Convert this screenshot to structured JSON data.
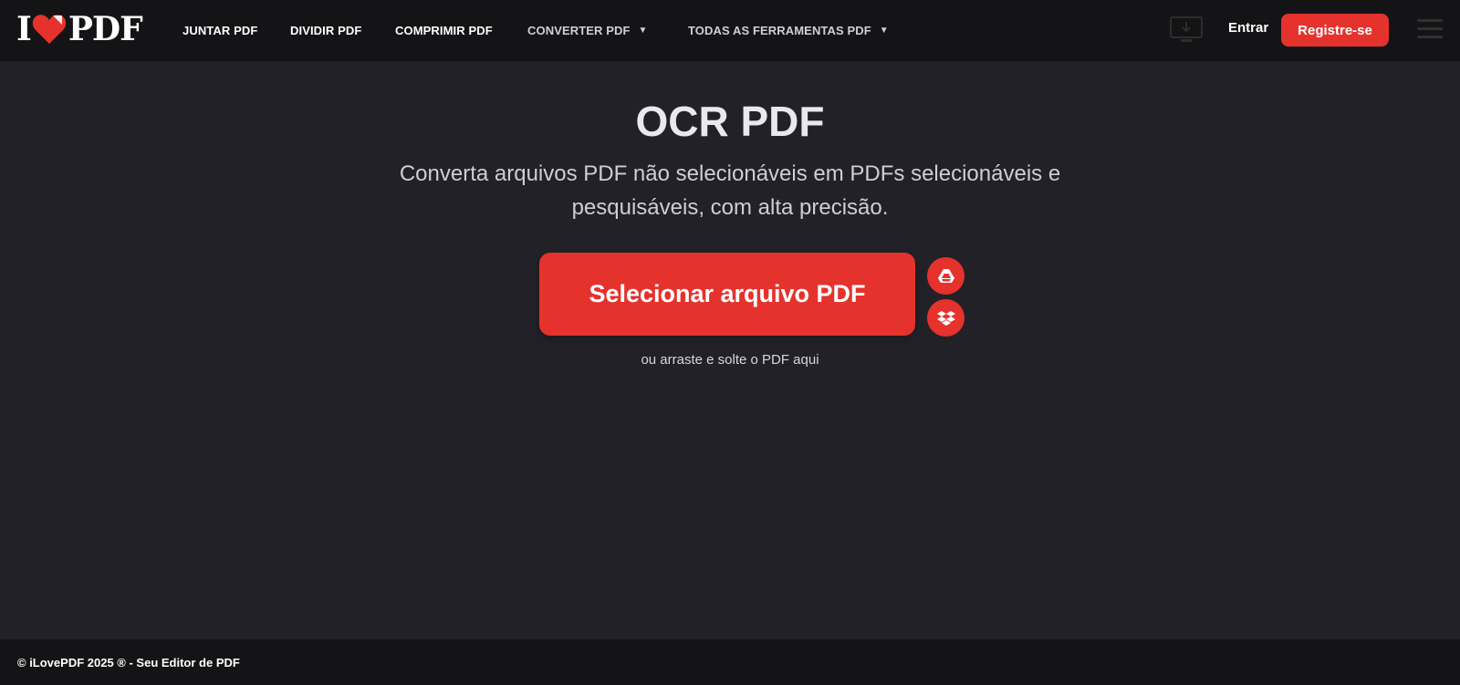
{
  "header": {
    "logo": {
      "prefix": "I",
      "suffix": "PDF",
      "accent_color": "#e5322d"
    },
    "nav": [
      {
        "label": "JUNTAR PDF"
      },
      {
        "label": "DIVIDIR PDF"
      },
      {
        "label": "COMPRIMIR PDF"
      },
      {
        "label": "CONVERTER PDF",
        "has_dropdown": true
      },
      {
        "label": "TODAS AS FERRAMENTAS PDF",
        "has_dropdown": true
      }
    ],
    "login_label": "Entrar",
    "register_label": "Registre-se",
    "icons": [
      "desktop-app-icon",
      "hamburger-menu-icon"
    ]
  },
  "main": {
    "title": "OCR PDF",
    "subtitle_line1": "Converta arquivos PDF não selecionáveis em PDFs selecionáveis e",
    "subtitle_line2": "pesquisáveis, com alta precisão.",
    "select_button_label": "Selecionar arquivo PDF",
    "cloud_buttons": [
      "google-drive-icon",
      "dropbox-icon"
    ],
    "drop_hint": "ou arraste e solte o PDF aqui"
  },
  "footer": {
    "text": "© iLovePDF 2025 ® - Seu Editor de PDF"
  },
  "colors": {
    "background": "#222127",
    "topbar": "#141416",
    "accent": "#e5322d"
  }
}
